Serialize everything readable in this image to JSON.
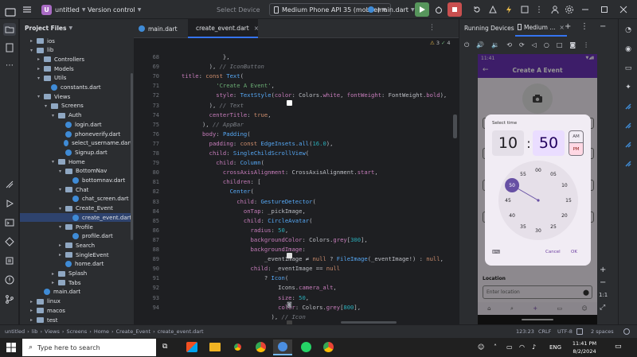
{
  "titlebar": {
    "project_badge": "U",
    "project_name": "untitled",
    "vcs": "Version control",
    "select_device": "Select Device",
    "device": "Medium Phone API 35 (mobile)",
    "run_config": "main.dart"
  },
  "project_panel": {
    "title": "Project Files"
  },
  "tree": [
    {
      "label": "ios",
      "depth": 1,
      "kind": "folder",
      "open": false
    },
    {
      "label": "lib",
      "depth": 1,
      "kind": "folder",
      "open": true
    },
    {
      "label": "Controllers",
      "depth": 2,
      "kind": "folder",
      "open": false
    },
    {
      "label": "Models",
      "depth": 2,
      "kind": "folder",
      "open": false
    },
    {
      "label": "Utils",
      "depth": 2,
      "kind": "folder",
      "open": true
    },
    {
      "label": "constants.dart",
      "depth": 3,
      "kind": "dart"
    },
    {
      "label": "Views",
      "depth": 2,
      "kind": "folder",
      "open": true
    },
    {
      "label": "Screens",
      "depth": 3,
      "kind": "folder",
      "open": true
    },
    {
      "label": "Auth",
      "depth": 4,
      "kind": "folder",
      "open": true
    },
    {
      "label": "login.dart",
      "depth": 5,
      "kind": "dart"
    },
    {
      "label": "phoneverify.dart",
      "depth": 5,
      "kind": "dart"
    },
    {
      "label": "select_username.dart",
      "depth": 5,
      "kind": "dart"
    },
    {
      "label": "Signup.dart",
      "depth": 5,
      "kind": "dart"
    },
    {
      "label": "Home",
      "depth": 4,
      "kind": "folder",
      "open": true
    },
    {
      "label": "BottomNav",
      "depth": 5,
      "kind": "folder",
      "open": true
    },
    {
      "label": "bottomnav.dart",
      "depth": 6,
      "kind": "dart"
    },
    {
      "label": "Chat",
      "depth": 5,
      "kind": "folder",
      "open": true
    },
    {
      "label": "chat_screen.dart",
      "depth": 6,
      "kind": "dart"
    },
    {
      "label": "Create_Event",
      "depth": 5,
      "kind": "folder",
      "open": true
    },
    {
      "label": "create_event.dart",
      "depth": 6,
      "kind": "dart",
      "selected": true
    },
    {
      "label": "Profile",
      "depth": 5,
      "kind": "folder",
      "open": true
    },
    {
      "label": "profile.dart",
      "depth": 6,
      "kind": "dart"
    },
    {
      "label": "Search",
      "depth": 5,
      "kind": "folder",
      "open": false
    },
    {
      "label": "SingleEvent",
      "depth": 5,
      "kind": "folder",
      "open": false
    },
    {
      "label": "home.dart",
      "depth": 5,
      "kind": "dart"
    },
    {
      "label": "Splash",
      "depth": 4,
      "kind": "folder",
      "open": false
    },
    {
      "label": "Tabs",
      "depth": 4,
      "kind": "folder",
      "open": false
    },
    {
      "label": "main.dart",
      "depth": 2,
      "kind": "dart"
    },
    {
      "label": "linux",
      "depth": 1,
      "kind": "folder",
      "open": false
    },
    {
      "label": "macos",
      "depth": 1,
      "kind": "folder",
      "open": false
    },
    {
      "label": "test",
      "depth": 1,
      "kind": "folder",
      "open": false
    }
  ],
  "editor": {
    "tabs": [
      {
        "label": "main.dart",
        "active": false
      },
      {
        "label": "create_event.dart",
        "active": true
      }
    ],
    "line_numbers": [
      "68",
      "69",
      "70",
      "71",
      "72",
      "73",
      "74",
      "75",
      "76",
      "77",
      "78",
      "79",
      "80",
      "81",
      "82",
      "83",
      "84",
      "85",
      "86",
      "87",
      "88",
      "89",
      "90",
      "91",
      "92",
      "93",
      "94"
    ],
    "lines": [
      [
        [
          "plain",
          "            },"
        ]
      ],
      [
        [
          "plain",
          "        ), "
        ],
        [
          "cmt",
          "// IconButton"
        ]
      ],
      [
        [
          "prop",
          "title"
        ],
        [
          "plain",
          ": "
        ],
        [
          "kw",
          "const "
        ],
        [
          "fn",
          "Text"
        ],
        [
          "plain",
          "("
        ]
      ],
      [
        [
          "str",
          "          'Create A Event'"
        ],
        [
          "plain",
          ","
        ]
      ],
      [
        [
          "prop",
          "          style"
        ],
        [
          "plain",
          ": "
        ],
        [
          "fn",
          "TextStyle"
        ],
        [
          "plain",
          "("
        ],
        [
          "prop",
          "color"
        ],
        [
          "plain",
          ": Colors."
        ],
        [
          "prop",
          "white"
        ],
        [
          "plain",
          ", "
        ],
        [
          "prop",
          "fontWeight"
        ],
        [
          "plain",
          ": FontWeight."
        ],
        [
          "prop",
          "bold"
        ],
        [
          "plain",
          "),"
        ]
      ],
      [
        [
          "plain",
          "        ), "
        ],
        [
          "cmt",
          "// Text"
        ]
      ],
      [
        [
          "prop",
          "        centerTitle"
        ],
        [
          "plain",
          ": "
        ],
        [
          "kw",
          "true"
        ],
        [
          "plain",
          ","
        ]
      ],
      [
        [
          "plain",
          "      ), "
        ],
        [
          "cmt",
          "// AppBar"
        ]
      ],
      [
        [
          "prop",
          "      body"
        ],
        [
          "plain",
          ": "
        ],
        [
          "fn",
          "Padding"
        ],
        [
          "plain",
          "("
        ]
      ],
      [
        [
          "prop",
          "        padding"
        ],
        [
          "plain",
          ": "
        ],
        [
          "kw",
          "const "
        ],
        [
          "fn",
          "EdgeInsets"
        ],
        [
          "plain",
          "."
        ],
        [
          "fn",
          "all"
        ],
        [
          "plain",
          "("
        ],
        [
          "num",
          "16.0"
        ],
        [
          "plain",
          "),"
        ]
      ],
      [
        [
          "prop",
          "        child"
        ],
        [
          "plain",
          ": "
        ],
        [
          "fn",
          "SingleChildScrollView"
        ],
        [
          "plain",
          "("
        ]
      ],
      [
        [
          "prop",
          "          child"
        ],
        [
          "plain",
          ": "
        ],
        [
          "fn",
          "Column"
        ],
        [
          "plain",
          "("
        ]
      ],
      [
        [
          "prop",
          "            crossAxisAlignment"
        ],
        [
          "plain",
          ": CrossAxisAlignment."
        ],
        [
          "prop",
          "start"
        ],
        [
          "plain",
          ","
        ]
      ],
      [
        [
          "prop",
          "            children"
        ],
        [
          "plain",
          ": ["
        ]
      ],
      [
        [
          "fn",
          "              Center"
        ],
        [
          "plain",
          "("
        ]
      ],
      [
        [
          "prop",
          "                child"
        ],
        [
          "plain",
          ": "
        ],
        [
          "fn",
          "GestureDetector"
        ],
        [
          "plain",
          "("
        ]
      ],
      [
        [
          "prop",
          "                  onTap"
        ],
        [
          "plain",
          ": _pickImage,"
        ]
      ],
      [
        [
          "prop",
          "                  child"
        ],
        [
          "plain",
          ": "
        ],
        [
          "fn",
          "CircleAvatar"
        ],
        [
          "plain",
          "("
        ]
      ],
      [
        [
          "prop",
          "                    radius"
        ],
        [
          "plain",
          ": "
        ],
        [
          "num",
          "50"
        ],
        [
          "plain",
          ","
        ]
      ],
      [
        [
          "prop",
          "                    backgroundColor"
        ],
        [
          "plain",
          ": Colors."
        ],
        [
          "prop",
          "grey"
        ],
        [
          "plain",
          "["
        ],
        [
          "num",
          "300"
        ],
        [
          "plain",
          "],"
        ]
      ],
      [
        [
          "prop",
          "                    backgroundImage"
        ],
        [
          "plain",
          ":"
        ]
      ],
      [
        [
          "plain",
          "                        _eventImage ≠ "
        ],
        [
          "kw",
          "null"
        ],
        [
          "plain",
          " ? "
        ],
        [
          "fn",
          "FileImage"
        ],
        [
          "plain",
          "(_eventImage!) : "
        ],
        [
          "kw",
          "null"
        ],
        [
          "plain",
          ","
        ]
      ],
      [
        [
          "prop",
          "                    child"
        ],
        [
          "plain",
          ": _eventImage == "
        ],
        [
          "kw",
          "null"
        ]
      ],
      [
        [
          "plain",
          "                        ? "
        ],
        [
          "fn",
          "Icon"
        ],
        [
          "plain",
          "("
        ]
      ],
      [
        [
          "plain",
          "                            Icons."
        ],
        [
          "prop",
          "camera_alt"
        ],
        [
          "plain",
          ","
        ]
      ],
      [
        [
          "prop",
          "                            size"
        ],
        [
          "plain",
          ": "
        ],
        [
          "num",
          "50"
        ],
        [
          "plain",
          ","
        ]
      ],
      [
        [
          "prop",
          "                            color"
        ],
        [
          "plain",
          ": Colors."
        ],
        [
          "prop",
          "grey"
        ],
        [
          "plain",
          "["
        ],
        [
          "num",
          "800"
        ],
        [
          "plain",
          "],"
        ]
      ],
      [
        [
          "plain",
          "                          ), "
        ],
        [
          "cmt",
          "// Icon"
        ]
      ]
    ]
  },
  "device_panel": {
    "title": "Running Devices",
    "device_tab": "Medium ..."
  },
  "phone": {
    "status_time": "11:41",
    "appbar_title": "Create A Event",
    "location_label": "Location",
    "location_placeholder": "Enter location",
    "dialog": {
      "title": "Select time",
      "hour": "10",
      "minute": "50",
      "am": "AM",
      "pm": "PM",
      "cancel": "Cancel",
      "ok": "OK",
      "selected_minute": "50",
      "dial_labels": [
        "00",
        "05",
        "10",
        "15",
        "20",
        "25",
        "30",
        "35",
        "40",
        "45",
        "50",
        "55"
      ]
    }
  },
  "status": {
    "breadcrumbs": [
      "untitled",
      "lib",
      "Views",
      "Screens",
      "Home",
      "Create_Event",
      "create_event.dart"
    ],
    "position": "123:23",
    "line_sep": "CRLF",
    "encoding": "UTF-8",
    "indent": "2 spaces"
  },
  "taskbar": {
    "search_placeholder": "Type here to search",
    "lang": "ENG",
    "time": "11:41 PM",
    "date": "8/2/2024"
  },
  "colors": {
    "accent": "#6d3fa0",
    "appbar": "#6a32b5",
    "primary_btn": "#6d3fa0"
  }
}
